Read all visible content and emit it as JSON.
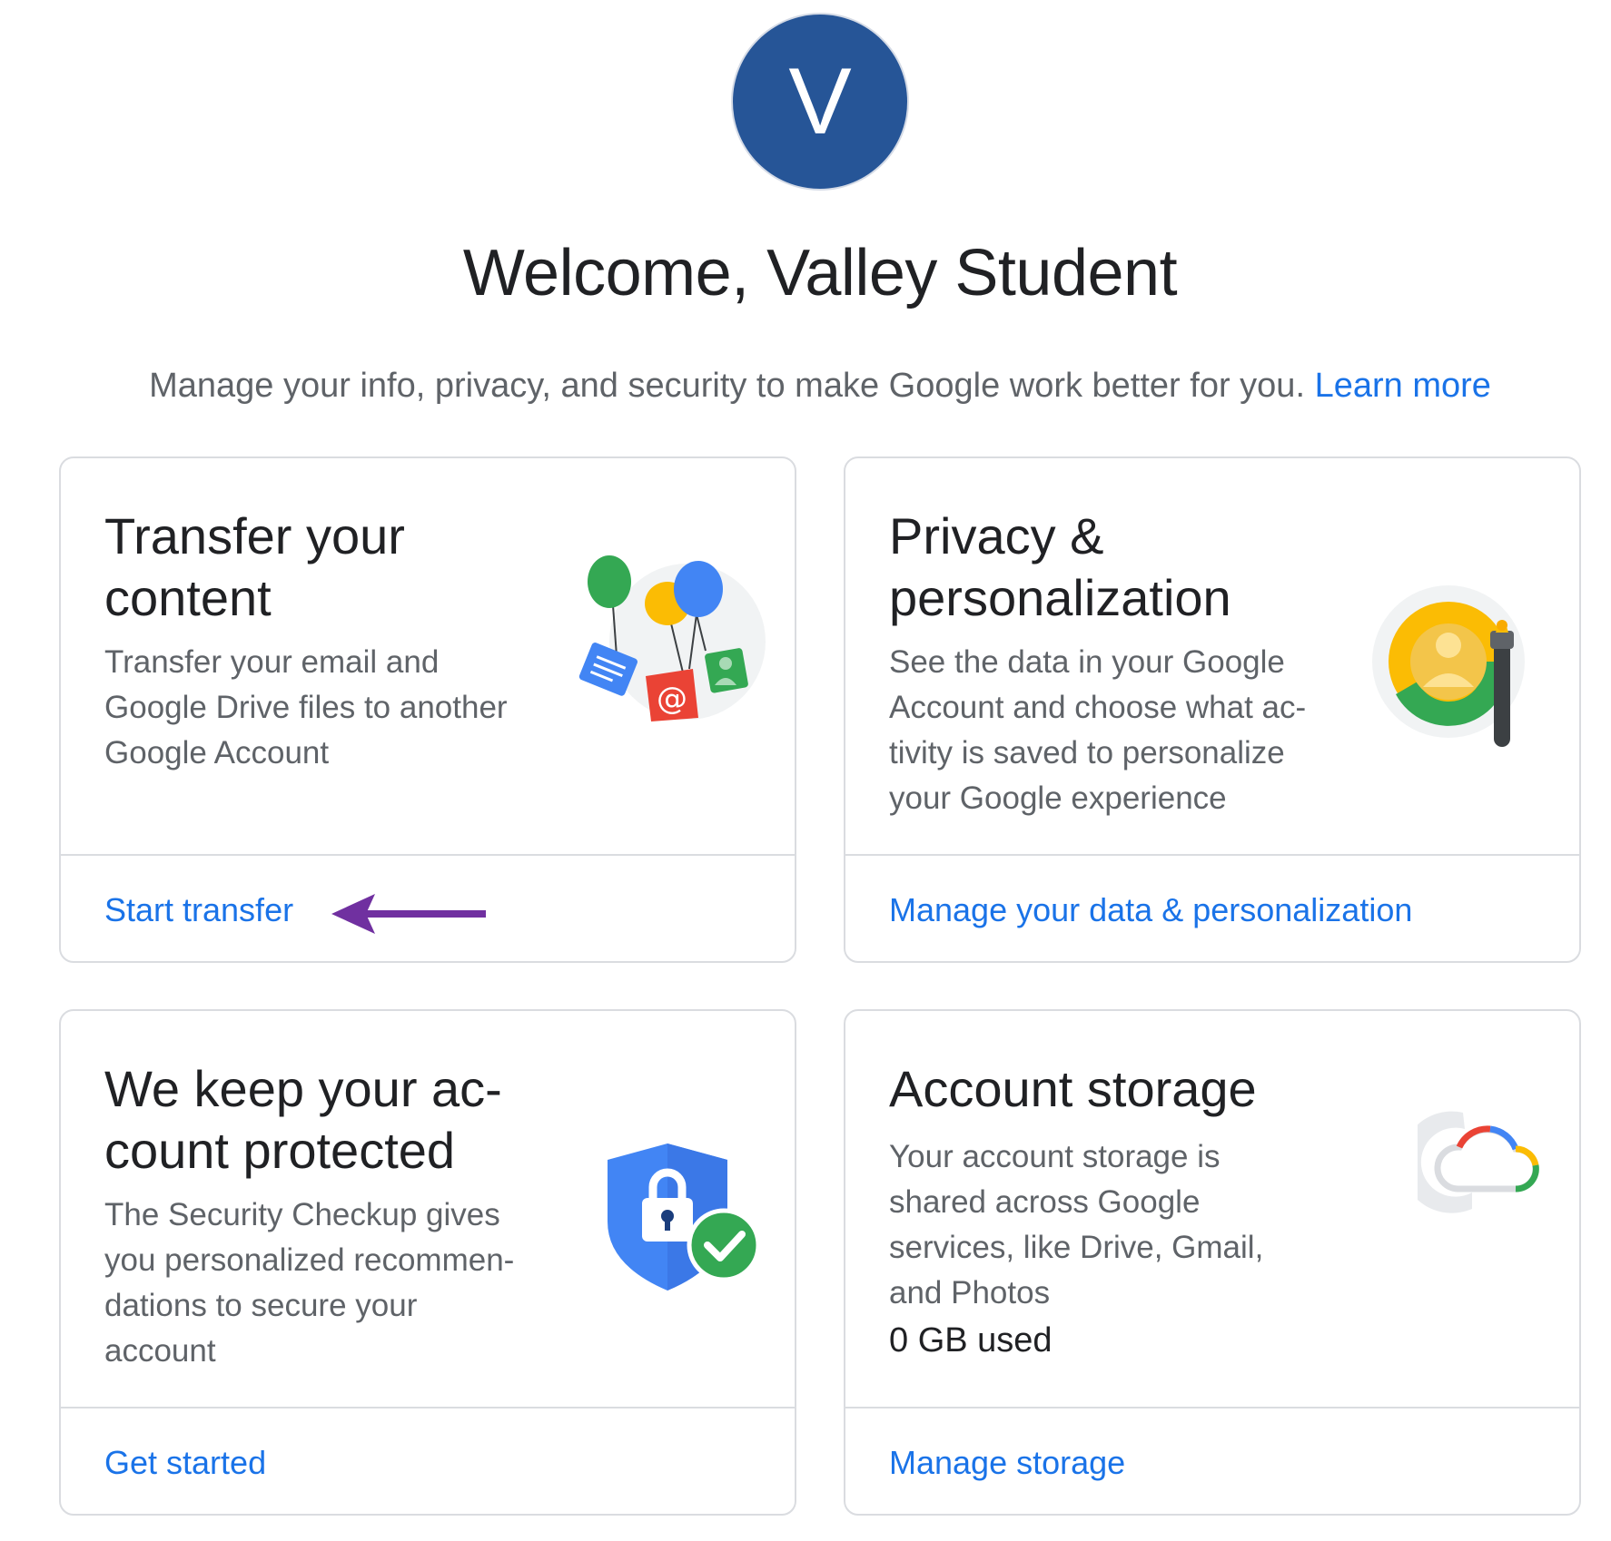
{
  "avatar": {
    "initial": "V",
    "color": "#265597"
  },
  "header": {
    "welcome": "Welcome, Valley Student",
    "subtitle": "Manage your info, privacy, and security to make Google work better for you.",
    "learn_more": "Learn more"
  },
  "cards": [
    {
      "title": "Transfer your content",
      "description": "Transfer your email and Google Drive files to another Google Account",
      "action": "Start transfer",
      "icon": "balloons-transfer-icon"
    },
    {
      "title": "Privacy & personalization",
      "description": "See the data in your Google Account and choose what ac-tivity is saved to personalize your Google experience",
      "action": "Manage your data & personalization",
      "icon": "privacy-paintbrush-icon"
    },
    {
      "title": "We keep your ac-count protected",
      "description": "The Security Checkup gives you personalized recommen-dations to secure your account",
      "action": "Get started",
      "icon": "security-shield-icon"
    },
    {
      "title": "Account storage",
      "description": "Your account storage is shared across Google services, like Drive, Gmail, and Photos",
      "usage": "0 GB used",
      "action": "Manage storage",
      "icon": "cloud-storage-icon"
    }
  ],
  "annotation": {
    "arrow_color": "#7030a0",
    "icon": "purple-arrow-icon"
  },
  "colors": {
    "link": "#1a73e8",
    "google_blue": "#4285f4",
    "google_green": "#34a853",
    "google_yellow": "#fbbc04",
    "google_red": "#ea4335"
  }
}
